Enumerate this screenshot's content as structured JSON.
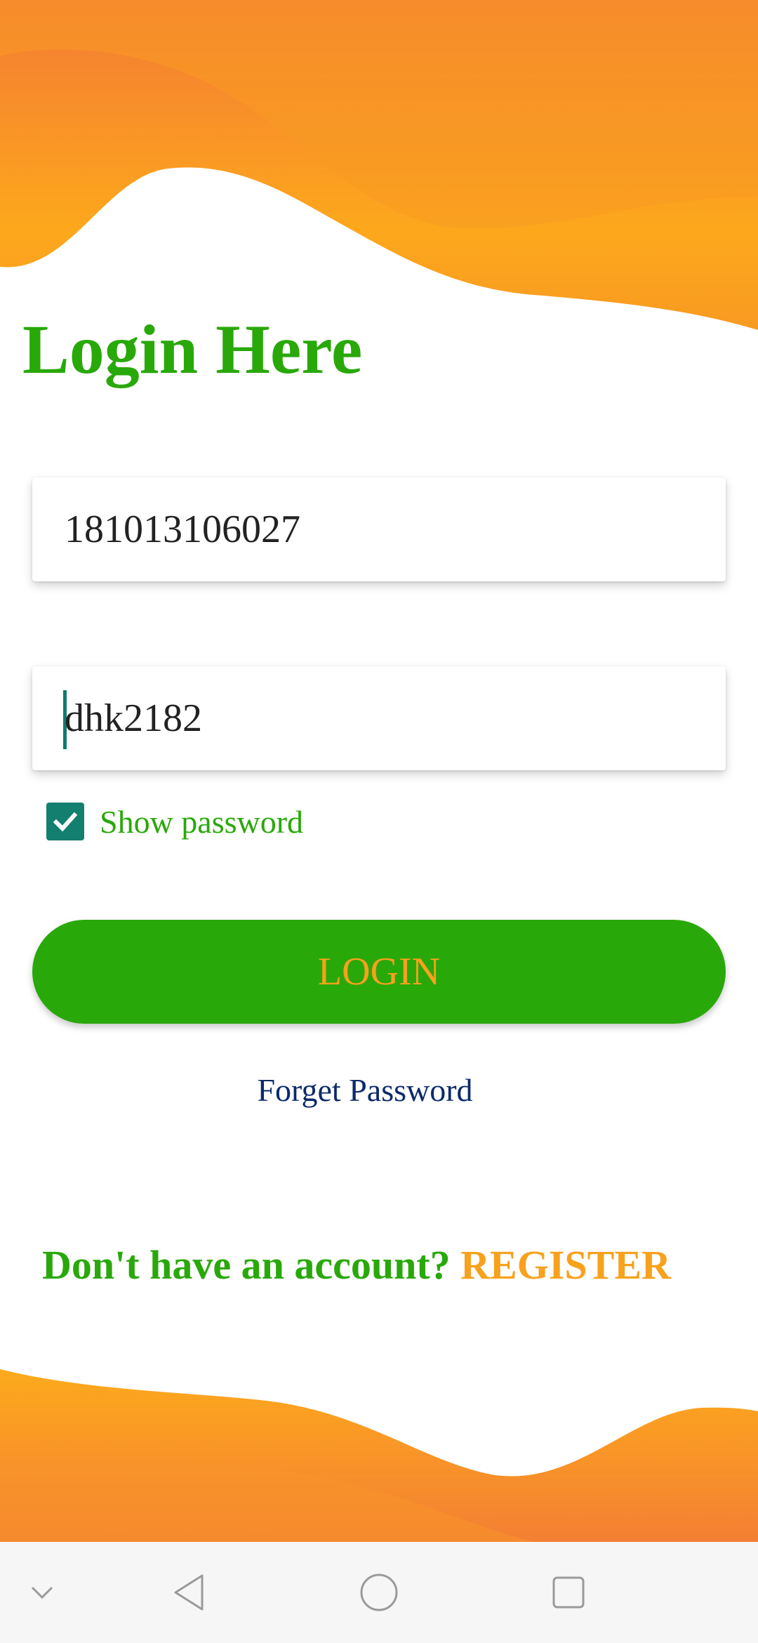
{
  "login": {
    "title": "Login Here",
    "username_value": "181013106027",
    "password_value": "dhk2182",
    "show_password_label": "Show password",
    "show_password_checked": true,
    "login_button_label": "LOGIN",
    "forget_password_label": "Forget Password",
    "register_prompt": "Don't have an account? ",
    "register_label": "REGISTER"
  },
  "colors": {
    "primary_green": "#29a80a",
    "accent_orange": "#f7a11c",
    "link_navy": "#0c2a6b",
    "checkbox_teal": "#137f6f"
  },
  "navbar": {
    "icons": [
      "chevron-down-icon",
      "back-icon",
      "home-icon",
      "recents-icon"
    ]
  }
}
